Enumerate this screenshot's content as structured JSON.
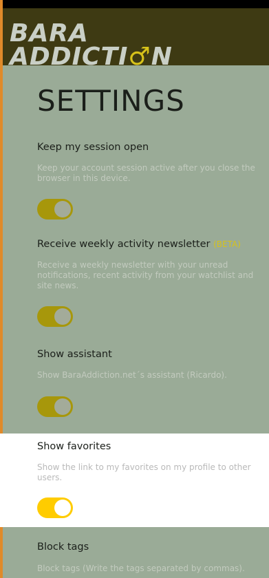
{
  "brand": {
    "logo_line1": "BARA",
    "logo_line2_prefix": "ADDICTI",
    "logo_line2_mars": "♂",
    "logo_line2_suffix": "N"
  },
  "page": {
    "title": "SETTINGS"
  },
  "settings": [
    {
      "title": "Keep my session open",
      "description": "Keep your account session active after you close the browser in this device.",
      "enabled": true
    },
    {
      "title": "Receive weekly activity newsletter",
      "badge": "(BETA)",
      "description": "Receive a weekly newsletter with your unread notifications, recent activity from your watchlist and site news.",
      "enabled": true
    },
    {
      "title": "Show assistant",
      "description": "Show BaraAddiction.net´s assistant (Ricardo).",
      "enabled": true
    },
    {
      "title": "Show favorites",
      "description": "Show the link to my favorites on my profile to other users.",
      "enabled": true
    },
    {
      "title": "Block tags",
      "description": "Block tags (Write the tags separated by commas)."
    }
  ],
  "colors": {
    "overlay": "#9aab97",
    "header": "#3e3a13",
    "accent": "#ffcc00",
    "accent_dimmed": "#a7970b",
    "highlight_bg": "#ffffff"
  }
}
